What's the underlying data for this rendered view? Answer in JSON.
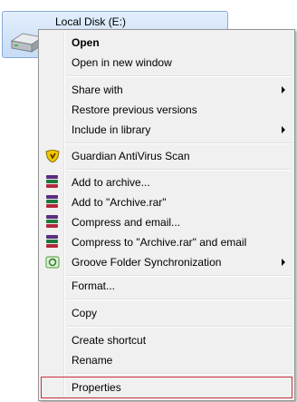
{
  "drive": {
    "label": "Local Disk (E:)",
    "icon": "hard-drive-icon"
  },
  "menu": {
    "items": [
      {
        "label": "Open",
        "bold": true
      },
      {
        "label": "Open in new window"
      },
      {
        "label": "Share with",
        "submenu": true
      },
      {
        "label": "Restore previous versions"
      },
      {
        "label": "Include in library",
        "submenu": true
      },
      {
        "label": "Guardian AntiVirus Scan",
        "icon": "shield-icon"
      },
      {
        "label": "Add to archive...",
        "icon": "archive-icon"
      },
      {
        "label": "Add to \"Archive.rar\"",
        "icon": "archive-icon"
      },
      {
        "label": "Compress and email...",
        "icon": "archive-icon"
      },
      {
        "label": "Compress to \"Archive.rar\" and email",
        "icon": "archive-icon"
      },
      {
        "label": "Groove Folder Synchronization",
        "icon": "groove-icon",
        "submenu": true
      },
      {
        "label": "Format..."
      },
      {
        "label": "Copy"
      },
      {
        "label": "Create shortcut"
      },
      {
        "label": "Rename"
      },
      {
        "label": "Properties",
        "highlighted": true
      }
    ]
  },
  "colors": {
    "highlight_border": "#c9303a",
    "menu_bg": "#f0f0f0",
    "drive_bg": "#c7dcf6"
  }
}
